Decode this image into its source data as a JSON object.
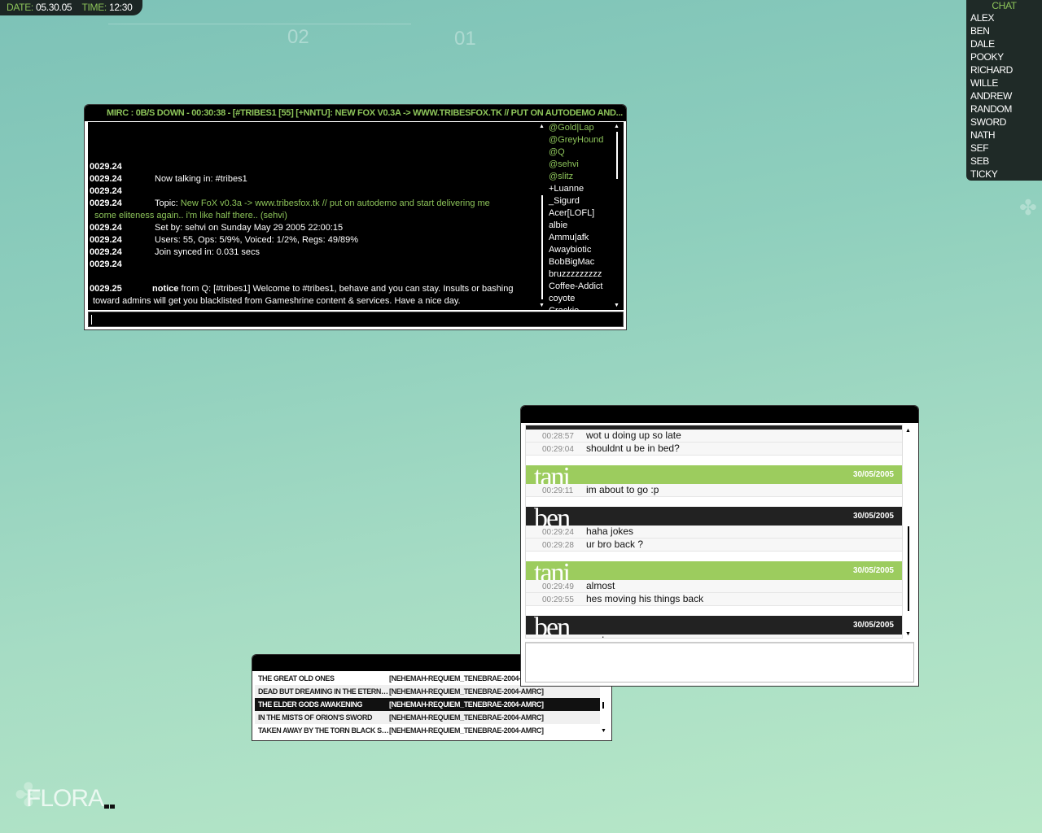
{
  "topbar": {
    "date_label": "DATE:",
    "date": "05.30.05",
    "time_label": "TIME:",
    "time": "12:30"
  },
  "widgets": {
    "num1": "02",
    "num2": "01"
  },
  "mirc": {
    "title": "MIRC : 0B/S DOWN - 00:30:38 - [#TRIBES1 [55] [+NNTU]: NEW FOX V0.3A -> WWW.TRIBESFOX.TK // PUT ON AUTODEMO AND...",
    "lines": [
      {
        "ts": "0029.24",
        "text": ""
      },
      {
        "ts": "0029.24",
        "text": "Now talking in: #tribes1"
      },
      {
        "ts": "0029.24",
        "text": ""
      },
      {
        "ts": "0029.24",
        "prefix": "Topic: ",
        "topic": "New FoX v0.3a -> www.tribesfox.tk // put on autodemo and start delivering me",
        "cont": "some eliteness again.. i'm like half there.. (sehvi)"
      },
      {
        "ts": "0029.24",
        "text": "Set by: sehvi on Sunday May 29 2005 22:00:15"
      },
      {
        "ts": "0029.24",
        "text": "Users: 55, Ops: 5/9%, Voiced: 1/2%, Regs: 49/89%"
      },
      {
        "ts": "0029.24",
        "text": "Join synced in: 0.031 secs"
      },
      {
        "ts": "0029.24",
        "text": ""
      }
    ],
    "notice": {
      "ts": "0029.25",
      "bold": "notice",
      "text": " from Q: [#tribes1] Welcome to #tribes1, behave and you can stay. Insults or bashing",
      "cont": "toward admins will get you blacklisted from Gameshrine content & services. Have a nice day."
    },
    "nicks": [
      {
        "n": "@Gold|Lap",
        "op": true
      },
      {
        "n": "@GreyHound",
        "op": true
      },
      {
        "n": "@Q",
        "op": true
      },
      {
        "n": "@sehvi",
        "op": true
      },
      {
        "n": "@slitz",
        "op": true
      },
      {
        "n": "+Luanne"
      },
      {
        "n": "_Sigurd"
      },
      {
        "n": "Acer[LOFL]"
      },
      {
        "n": "albie"
      },
      {
        "n": "Ammu|afk"
      },
      {
        "n": "Awaybiotic"
      },
      {
        "n": "BobBigMac"
      },
      {
        "n": "bruzzzzzzzzz"
      },
      {
        "n": "Coffee-Addict"
      },
      {
        "n": "coyote"
      },
      {
        "n": "Crackie"
      }
    ],
    "input_value": ""
  },
  "msn": {
    "groups": [
      {
        "name": "",
        "style": "k",
        "date": "",
        "msgs": [
          {
            "t": "00:28:57",
            "m": "wot u doing up so late"
          },
          {
            "t": "00:29:04",
            "m": "shouldnt u be in bed?"
          }
        ]
      },
      {
        "name": "tani",
        "style": "g",
        "date": "30/05/2005",
        "msgs": [
          {
            "t": "00:29:11",
            "m": "im about to go :p"
          }
        ]
      },
      {
        "name": "ben",
        "style": "k",
        "date": "30/05/2005",
        "msgs": [
          {
            "t": "00:29:24",
            "m": "haha jokes"
          },
          {
            "t": "00:29:28",
            "m": "ur bro back ?"
          }
        ]
      },
      {
        "name": "tani",
        "style": "g",
        "date": "30/05/2005",
        "msgs": [
          {
            "t": "00:29:49",
            "m": "almost"
          },
          {
            "t": "00:29:55",
            "m": "hes moving his things back"
          }
        ]
      },
      {
        "name": "ben",
        "style": "k",
        "date": "30/05/2005",
        "msgs": [
          {
            "t": "",
            "m": "cool"
          }
        ]
      }
    ],
    "input_value": ""
  },
  "playlist": [
    {
      "title": "THE GREAT OLD ONES",
      "album": "[NEHEMAH-REQUIEM_TENEBRAE-2004-AMRC]"
    },
    {
      "title": "DEAD BUT DREAMING IN THE ETERNAL ICY...",
      "album": "[NEHEMAH-REQUIEM_TENEBRAE-2004-AMRC]"
    },
    {
      "title": "THE ELDER GODS AWAKENING",
      "album": "[NEHEMAH-REQUIEM_TENEBRAE-2004-AMRC]",
      "selected": true
    },
    {
      "title": "IN THE MISTS OF ORION'S SWORD",
      "album": "[NEHEMAH-REQUIEM_TENEBRAE-2004-AMRC]"
    },
    {
      "title": "TAKEN AWAY BY THE TORN BLACK SHROUD",
      "album": "[NEHEMAH-REQUIEM_TENEBRAE-2004-AMRC]"
    }
  ],
  "buddies": {
    "header": "CHAT",
    "names": [
      "ALEX",
      "BEN",
      "DALE",
      "POOKY",
      "RICHARD",
      "WILLE",
      "ANDREW",
      "RANDOM",
      "SWORD",
      "NATH",
      "SEF",
      "SEB",
      "TICKY"
    ]
  },
  "brand": "FLORA",
  "colors": {
    "accent": "#8dc45a",
    "tani": "#9ccc5e",
    "ben": "#222222",
    "panel": "#1f2a27"
  }
}
